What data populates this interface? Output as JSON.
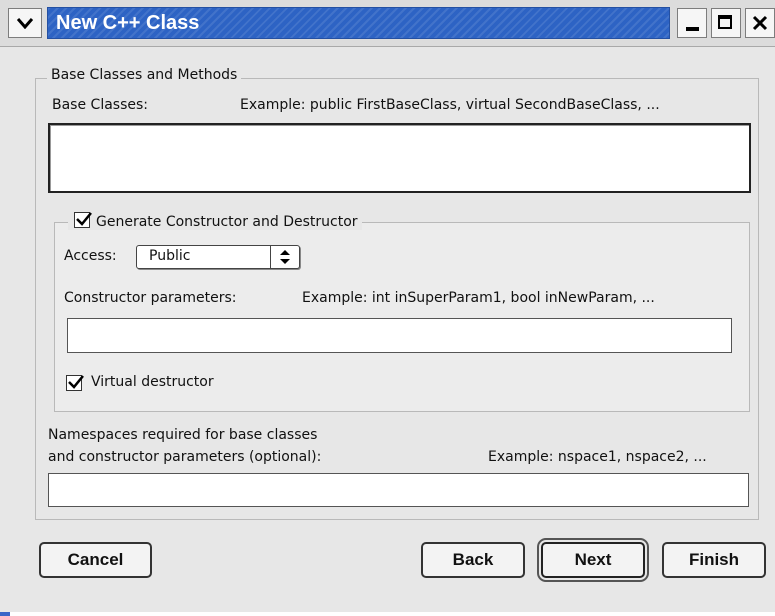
{
  "window": {
    "title": "New C++ Class"
  },
  "base_section": {
    "legend": "Base Classes and Methods",
    "base_classes_label": "Base Classes:",
    "base_classes_example": "Example: public FirstBaseClass, virtual SecondBaseClass, ...",
    "base_classes_value": ""
  },
  "ctor_section": {
    "legend": "Generate Constructor and Destructor",
    "generate_checked": true,
    "access_label": "Access:",
    "access_value": "Public",
    "params_label": "Constructor parameters:",
    "params_example": "Example: int inSuperParam1, bool inNewParam, ...",
    "params_value": "",
    "virtual_destructor_label": "Virtual destructor",
    "virtual_destructor_checked": true
  },
  "namespaces": {
    "label_line1": "Namespaces required for base classes",
    "label_line2": "and constructor parameters (optional):",
    "example": "Example: nspace1, nspace2, ...",
    "value": ""
  },
  "buttons": {
    "cancel": "Cancel",
    "back": "Back",
    "next": "Next",
    "finish": "Finish"
  },
  "colors": {
    "title_bar": "#2d63c4",
    "dialog_background": "#e7e7e7"
  }
}
